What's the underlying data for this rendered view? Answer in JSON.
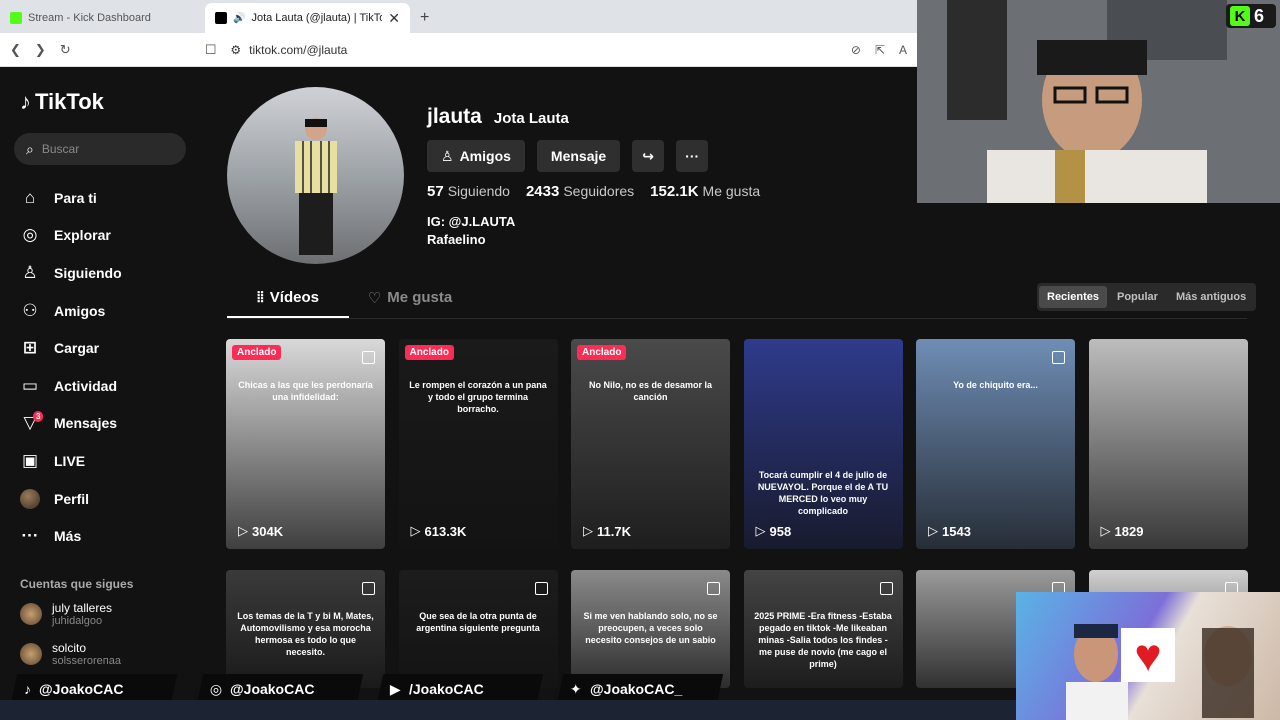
{
  "browser": {
    "tabs": [
      {
        "title": "Stream - Kick Dashboard",
        "active": false
      },
      {
        "title": "Jota Lauta (@jlauta) | TikTok",
        "active": true
      }
    ],
    "url": "tiktok.com/@jlauta"
  },
  "sidebar": {
    "logo": "TikTok",
    "search_placeholder": "Buscar",
    "nav": [
      {
        "label": "Para ti",
        "icon": "home-icon"
      },
      {
        "label": "Explorar",
        "icon": "compass-icon"
      },
      {
        "label": "Siguiendo",
        "icon": "user-follow-icon"
      },
      {
        "label": "Amigos",
        "icon": "friends-icon"
      },
      {
        "label": "Cargar",
        "icon": "upload-icon"
      },
      {
        "label": "Actividad",
        "icon": "activity-icon"
      },
      {
        "label": "Mensajes",
        "icon": "messages-icon",
        "badge": "3"
      },
      {
        "label": "LIVE",
        "icon": "live-icon"
      },
      {
        "label": "Perfil",
        "icon": "avatar"
      },
      {
        "label": "Más",
        "icon": "more-icon"
      }
    ],
    "following_heading": "Cuentas que sigues",
    "following": [
      {
        "name": "july talleres",
        "user": "juhidalgoo"
      },
      {
        "name": "solcito",
        "user": "solsseroreпaa"
      }
    ]
  },
  "profile": {
    "handle": "jlauta",
    "name": "Jota Lauta",
    "buttons": {
      "friends": "Amigos",
      "message": "Mensaje"
    },
    "stats": [
      {
        "value": "57",
        "label": "Siguiendo"
      },
      {
        "value": "2433",
        "label": "Seguidores"
      },
      {
        "value": "152.1K",
        "label": "Me gusta"
      }
    ],
    "bio_line1": "IG: @J.LAUTA",
    "bio_line2": "Rafaelino",
    "tabs": [
      "Vídeos",
      "Me gusta"
    ],
    "sort": [
      "Recientes",
      "Popular",
      "Más antiguos"
    ]
  },
  "videos": [
    {
      "pinned": "Anclado",
      "caption": "Chicas a las que les perdonaría una infidelidad:",
      "views": "304K",
      "bg": "#d9d9d9"
    },
    {
      "pinned": "Anclado",
      "caption": "Le rompen el corazón a un pana y todo el grupo termina borracho.",
      "views": "613.3K",
      "bg": "#1a1a1a"
    },
    {
      "pinned": "Anclado",
      "caption": "No Nilo, no es de desamor la canción",
      "views": "11.7K",
      "bg": "#4a4a4a"
    },
    {
      "pinned": "",
      "caption": "Tocará cumplir el 4 de julio de NUEVAYOL. Porque el de A TU MERCED lo veo muy complicado",
      "views": "958",
      "bg": "#2f3b8c"
    },
    {
      "pinned": "",
      "caption": "Yo de chiquito era...",
      "views": "1543",
      "bg": "#6f8db5"
    },
    {
      "pinned": "",
      "caption": "",
      "views": "1829",
      "bg": "#bdbdbd"
    },
    {
      "pinned": "",
      "caption": "Los temas de la T y bi M, Mates, Automovilismo y esa morocha hermosa es todo lo que necesito.",
      "views": "",
      "bg": "#3a3a3a"
    },
    {
      "pinned": "",
      "caption": "Que sea de la otra punta de argentina siguiente pregunta",
      "views": "",
      "bg": "#1c1c1c"
    },
    {
      "pinned": "",
      "caption": "Si me ven hablando solo, no se preocupen, a veces solo necesito consejos de un sabio",
      "views": "",
      "bg": "#8a8a8a"
    },
    {
      "pinned": "",
      "caption": "2025 PRIME -Era fitness -Estaba pegado en tiktok -Me likeaban minas -Salia todos los findes -me puse de novio (me cago el prime)",
      "views": "",
      "bg": "#444"
    },
    {
      "pinned": "",
      "caption": "",
      "views": "",
      "bg": "#9a9a9a"
    },
    {
      "pinned": "",
      "caption": "",
      "views": "",
      "bg": "#d0d0d0"
    }
  ],
  "overlay": {
    "kick_count": "6",
    "socials": [
      {
        "icon": "tiktok-icon",
        "label": "@JoakoCAC"
      },
      {
        "icon": "instagram-icon",
        "label": "@JoakoCAC"
      },
      {
        "icon": "youtube-icon",
        "label": "/JoakoCAC"
      },
      {
        "icon": "twitter-icon",
        "label": "@JoakoCAC_"
      }
    ]
  },
  "colors": {
    "accent": "#fe2c55",
    "kick": "#53fc18"
  }
}
